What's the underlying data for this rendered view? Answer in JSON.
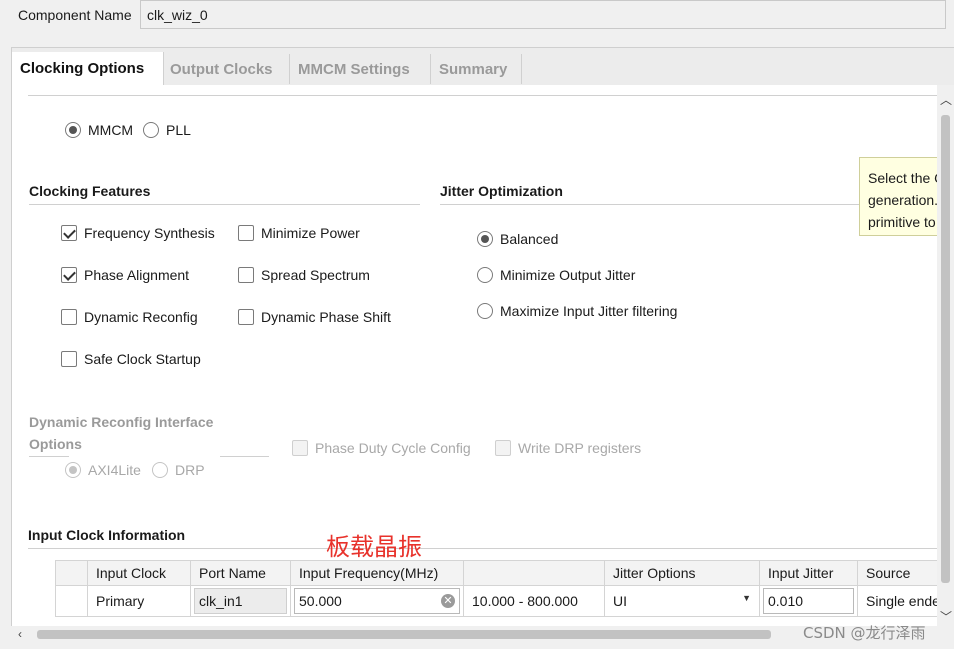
{
  "component": {
    "label": "Component Name",
    "value": "clk_wiz_0"
  },
  "tabs": [
    "Clocking Options",
    "Output Clocks",
    "MMCM Settings",
    "Summary"
  ],
  "primitive": {
    "mmcm": "MMCM",
    "pll": "PLL",
    "selected": "MMCM"
  },
  "clocking_features": {
    "title": "Clocking Features",
    "frequency_synthesis": "Frequency Synthesis",
    "minimize_power": "Minimize Power",
    "phase_alignment": "Phase Alignment",
    "spread_spectrum": "Spread Spectrum",
    "dynamic_reconfig": "Dynamic Reconfig",
    "dynamic_phase_shift": "Dynamic Phase Shift",
    "safe_clock_startup": "Safe Clock Startup"
  },
  "jitter": {
    "title": "Jitter Optimization",
    "balanced": "Balanced",
    "minimize_output": "Minimize Output Jitter",
    "maximize_input": "Maximize Input Jitter filtering",
    "selected": "Balanced"
  },
  "tooltip": {
    "line1": "Select the Clo",
    "line2": "generation. S",
    "line3": "primitive to us"
  },
  "dynamic_reconfig_interface": {
    "title_line1": "Dynamic Reconfig Interface",
    "title_line2": "Options",
    "axi4lite": "AXI4Lite",
    "drp": "DRP",
    "phase_duty": "Phase Duty Cycle Config",
    "write_drp": "Write DRP registers"
  },
  "input_clock": {
    "title": "Input Clock Information",
    "annotation": "板载晶振",
    "columns": [
      "",
      "Input Clock",
      "Port Name",
      "Input Frequency(MHz)",
      "",
      "Jitter Options",
      "Input Jitter",
      "Source"
    ],
    "rows": [
      {
        "clock": "Primary",
        "port": "clk_in1",
        "freq": "50.000",
        "range": "10.000 - 800.000",
        "jitter_opt": "UI",
        "input_jitter": "0.010",
        "source": "Single ended"
      }
    ]
  },
  "watermark": "CSDN @龙行泽雨",
  "colors": {
    "annotation": "#e8322b",
    "tooltip_bg": "#ffffe1",
    "panel_bg": "#ffffff"
  }
}
